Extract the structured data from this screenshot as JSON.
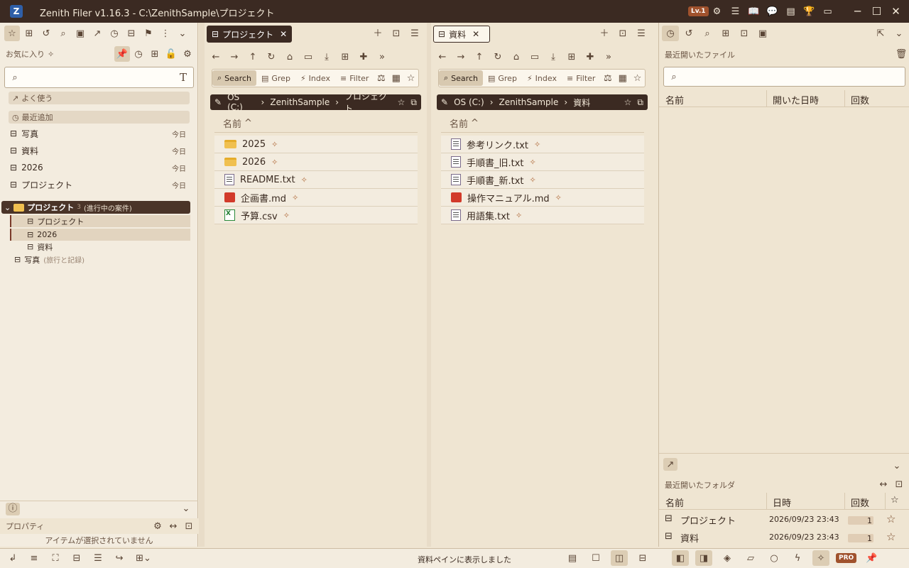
{
  "title_bar": {
    "app_title": "Zenith Filer v1.16.3 - C:\\ZenithSample\\プロジェクト",
    "level": "Lv.1"
  },
  "left": {
    "favorites_label": "お気に入り",
    "frequent_label": "よく使う",
    "recent_label": "最近追加",
    "recent_items": [
      {
        "name": "写真",
        "when": "今日"
      },
      {
        "name": "資料",
        "when": "今日"
      },
      {
        "name": "2026",
        "when": "今日"
      },
      {
        "name": "プロジェクト",
        "when": "今日"
      }
    ],
    "tree_group": {
      "name": "プロジェクト",
      "count": "3",
      "note": "(進行中の案件)"
    },
    "tree_children": [
      "プロジェクト",
      "2026",
      "資料"
    ],
    "tree_other": {
      "name": "写真",
      "note": "(旅行と記録)"
    },
    "properties_label": "プロパティ",
    "no_selection": "アイテムが選択されていません"
  },
  "pane1": {
    "tab": "プロジェクト",
    "filters": {
      "search": "Search",
      "grep": "Grep",
      "index": "Index",
      "filter": "Filter"
    },
    "crumbs": [
      "OS (C:)",
      "ZenithSample",
      "プロジェクト"
    ],
    "col_name": "名前",
    "files": [
      {
        "name": "2025",
        "type": "folder"
      },
      {
        "name": "2026",
        "type": "folder"
      },
      {
        "name": "README.txt",
        "type": "txt"
      },
      {
        "name": "企画書.md",
        "type": "md"
      },
      {
        "name": "予算.csv",
        "type": "csv"
      }
    ]
  },
  "pane2": {
    "tab": "資料",
    "filters": {
      "search": "Search",
      "grep": "Grep",
      "index": "Index",
      "filter": "Filter"
    },
    "crumbs": [
      "OS (C:)",
      "ZenithSample",
      "資料"
    ],
    "col_name": "名前",
    "files": [
      {
        "name": "参考リンク.txt",
        "type": "txt"
      },
      {
        "name": "手順書_旧.txt",
        "type": "txt"
      },
      {
        "name": "手順書_新.txt",
        "type": "txt"
      },
      {
        "name": "操作マニュアル.md",
        "type": "md"
      },
      {
        "name": "用語集.txt",
        "type": "txt"
      }
    ]
  },
  "right": {
    "recent_files_label": "最近開いたファイル",
    "cols": {
      "name": "名前",
      "opened": "開いた日時",
      "count": "回数"
    },
    "recent_folders_label": "最近開いたフォルダ",
    "folder_cols": {
      "name": "名前",
      "date": "日時",
      "count": "回数"
    },
    "folders": [
      {
        "name": "プロジェクト",
        "date": "2026/09/23 23:43",
        "count": "1"
      },
      {
        "name": "資料",
        "date": "2026/09/23 23:43",
        "count": "1"
      }
    ]
  },
  "status": {
    "message": "資料ペインに表示しました",
    "badge": "PRO"
  }
}
